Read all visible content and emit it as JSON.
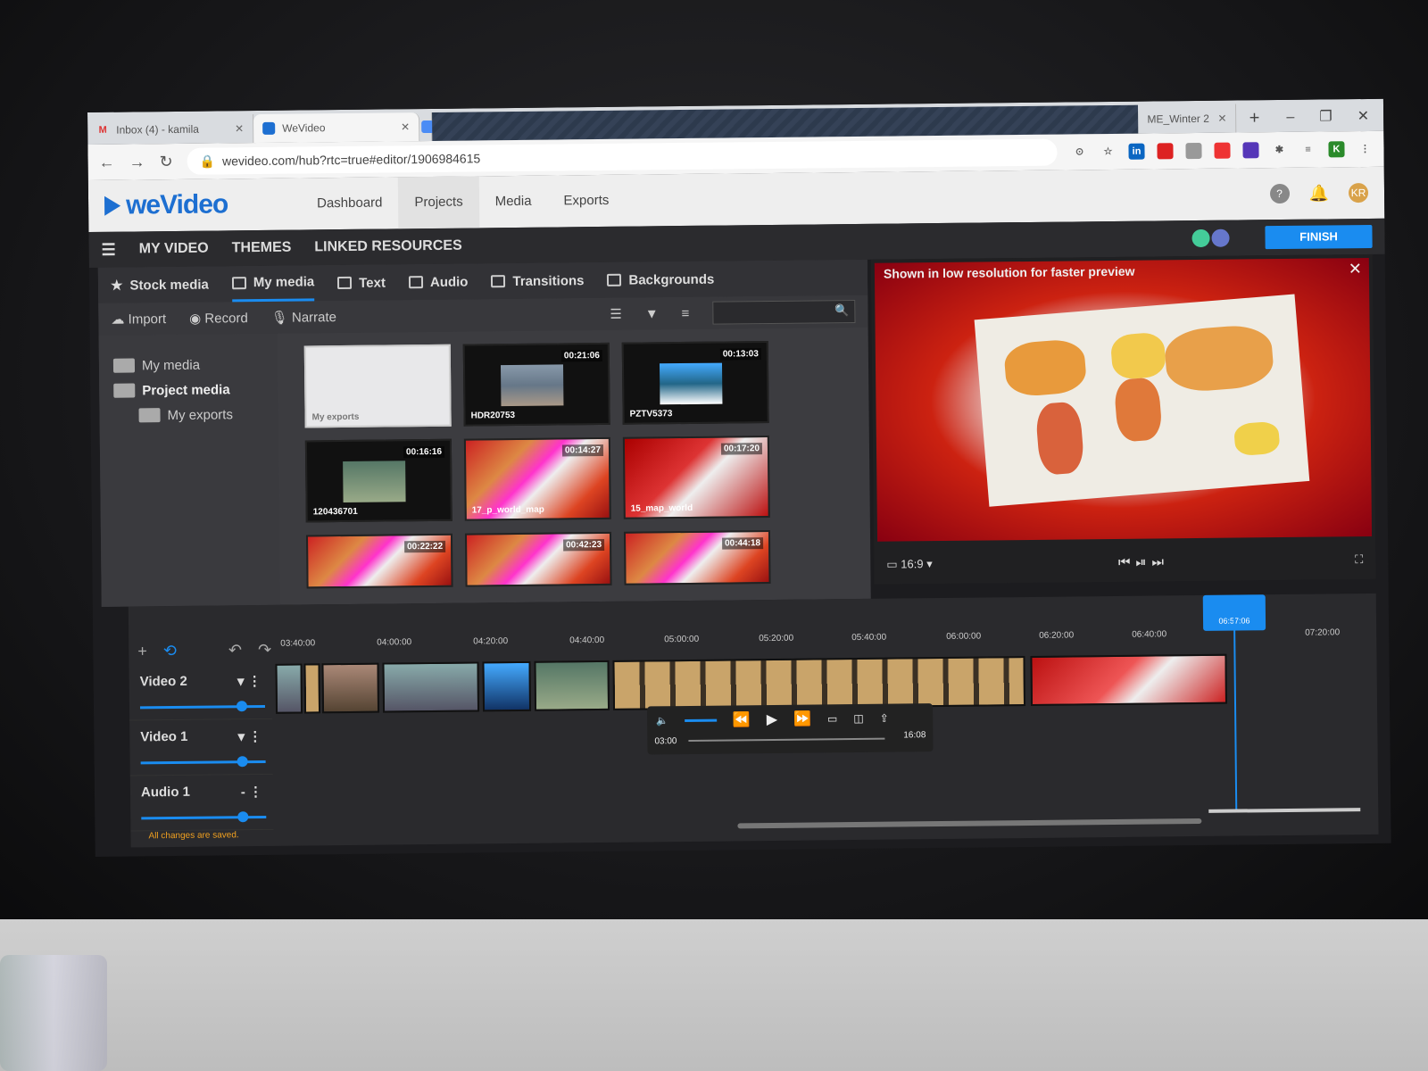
{
  "browser": {
    "tabs": [
      {
        "icon": "gmail-icon",
        "label": "Inbox (4) - kamila"
      },
      {
        "icon": "wevideo-icon",
        "label": "WeVideo"
      },
      {
        "icon": "docs-icon",
        "label": ""
      },
      {
        "icon": "tab-icon",
        "label": "ME_Winter 2"
      }
    ],
    "url": "wevideo.com/hub?rtc=true#editor/1906984615",
    "avatar_letter": "K"
  },
  "app": {
    "logo": "weVideo",
    "nav": [
      "Dashboard",
      "Projects",
      "Media",
      "Exports"
    ],
    "active_nav": "Projects",
    "user_initials": "KR"
  },
  "project": {
    "title": "MY VIDEO",
    "themes": "THEMES",
    "linked": "LINKED RESOURCES",
    "finish": "FINISH"
  },
  "media": {
    "tabs": [
      "Stock media",
      "My media",
      "Text",
      "Audio",
      "Transitions",
      "Backgrounds"
    ],
    "active_tab": "My media",
    "tools": [
      "Import",
      "Record",
      "Narrate"
    ],
    "tree": [
      "My media",
      "Project media",
      "My exports"
    ],
    "items": [
      {
        "type": "folder",
        "name": "My exports",
        "dur": ""
      },
      {
        "type": "dark",
        "name": "HDR20753",
        "dur": "00:21:06"
      },
      {
        "type": "dark",
        "name": "PZTV5373",
        "dur": "00:13:03"
      },
      {
        "type": "dark",
        "name": "120436701",
        "dur": "00:16:16"
      },
      {
        "type": "map",
        "name": "17_p_world_map",
        "dur": "00:14:27"
      },
      {
        "type": "red",
        "name": "15_map_world",
        "dur": "00:17:20"
      },
      {
        "type": "map",
        "name": "",
        "dur": "00:22:22"
      },
      {
        "type": "map",
        "name": "",
        "dur": "00:42:23"
      },
      {
        "type": "map",
        "name": "",
        "dur": "00:44:18"
      }
    ]
  },
  "preview": {
    "hint": "Shown in low resolution for faster preview",
    "ratio": "16:9"
  },
  "timeline": {
    "ticks": [
      "03:40:00",
      "04:00:00",
      "04:20:00",
      "04:40:00",
      "05:00:00",
      "05:20:00",
      "05:40:00",
      "06:00:00",
      "06:20:00",
      "06:40:00",
      "07:20:00"
    ],
    "playhead_time": "06:57:06",
    "tracks": [
      "Video 2",
      "Video 1",
      "Audio 1"
    ],
    "player_current": "03:00",
    "player_total": "16:08",
    "status": "All changes are saved."
  }
}
